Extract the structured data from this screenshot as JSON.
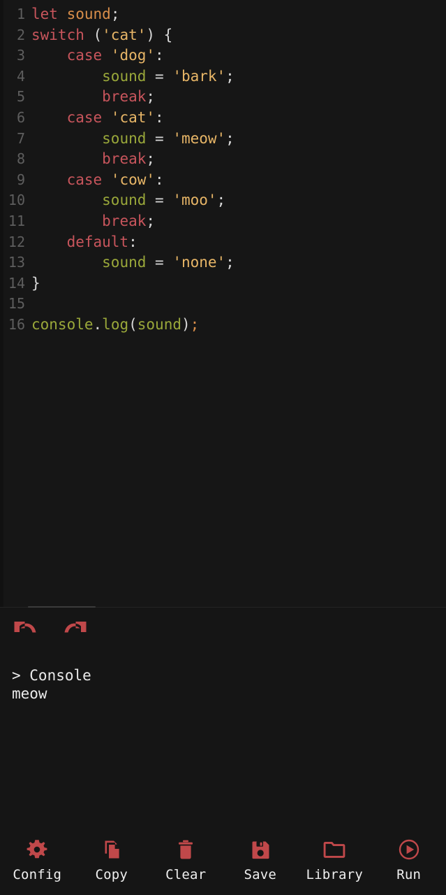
{
  "theme": {
    "background": "#151515",
    "editor_background": "#161616",
    "accent_red": "#c0484a",
    "keyword_color": "#c8555c",
    "string_color": "#e8b667",
    "variable_color": "#9aa83a",
    "declaration_color": "#d98e4a",
    "punctuation_color": "#d8d8d8",
    "line_number_color": "#5e5e5e",
    "console_text_color": "#eaeaea"
  },
  "editor": {
    "language": "javascript",
    "line_count": 16,
    "lines": [
      {
        "number": "1",
        "tokens": [
          {
            "t": "let",
            "c": "t-kw"
          },
          {
            "t": " ",
            "c": "t-plain"
          },
          {
            "t": "sound",
            "c": "t-decl"
          },
          {
            "t": ";",
            "c": "t-punc"
          }
        ]
      },
      {
        "number": "2",
        "tokens": [
          {
            "t": "switch",
            "c": "t-kw"
          },
          {
            "t": " (",
            "c": "t-punc"
          },
          {
            "t": "'cat'",
            "c": "t-str"
          },
          {
            "t": ") {",
            "c": "t-punc"
          }
        ]
      },
      {
        "number": "3",
        "tokens": [
          {
            "t": "    ",
            "c": "t-plain"
          },
          {
            "t": "case",
            "c": "t-kw"
          },
          {
            "t": " ",
            "c": "t-plain"
          },
          {
            "t": "'dog'",
            "c": "t-str"
          },
          {
            "t": ":",
            "c": "t-punc"
          }
        ]
      },
      {
        "number": "4",
        "tokens": [
          {
            "t": "        ",
            "c": "t-plain"
          },
          {
            "t": "sound",
            "c": "t-var"
          },
          {
            "t": " = ",
            "c": "t-punc"
          },
          {
            "t": "'bark'",
            "c": "t-str"
          },
          {
            "t": ";",
            "c": "t-punc"
          }
        ]
      },
      {
        "number": "5",
        "tokens": [
          {
            "t": "        ",
            "c": "t-plain"
          },
          {
            "t": "break",
            "c": "t-kw"
          },
          {
            "t": ";",
            "c": "t-punc"
          }
        ]
      },
      {
        "number": "6",
        "tokens": [
          {
            "t": "    ",
            "c": "t-plain"
          },
          {
            "t": "case",
            "c": "t-kw"
          },
          {
            "t": " ",
            "c": "t-plain"
          },
          {
            "t": "'cat'",
            "c": "t-str"
          },
          {
            "t": ":",
            "c": "t-punc"
          }
        ]
      },
      {
        "number": "7",
        "tokens": [
          {
            "t": "        ",
            "c": "t-plain"
          },
          {
            "t": "sound",
            "c": "t-var"
          },
          {
            "t": " = ",
            "c": "t-punc"
          },
          {
            "t": "'meow'",
            "c": "t-str"
          },
          {
            "t": ";",
            "c": "t-punc"
          }
        ]
      },
      {
        "number": "8",
        "tokens": [
          {
            "t": "        ",
            "c": "t-plain"
          },
          {
            "t": "break",
            "c": "t-kw"
          },
          {
            "t": ";",
            "c": "t-punc"
          }
        ]
      },
      {
        "number": "9",
        "tokens": [
          {
            "t": "    ",
            "c": "t-plain"
          },
          {
            "t": "case",
            "c": "t-kw"
          },
          {
            "t": " ",
            "c": "t-plain"
          },
          {
            "t": "'cow'",
            "c": "t-str"
          },
          {
            "t": ":",
            "c": "t-punc"
          }
        ]
      },
      {
        "number": "10",
        "tokens": [
          {
            "t": "        ",
            "c": "t-plain"
          },
          {
            "t": "sound",
            "c": "t-var"
          },
          {
            "t": " = ",
            "c": "t-punc"
          },
          {
            "t": "'moo'",
            "c": "t-str"
          },
          {
            "t": ";",
            "c": "t-punc"
          }
        ]
      },
      {
        "number": "11",
        "tokens": [
          {
            "t": "        ",
            "c": "t-plain"
          },
          {
            "t": "break",
            "c": "t-kw"
          },
          {
            "t": ";",
            "c": "t-punc"
          }
        ]
      },
      {
        "number": "12",
        "tokens": [
          {
            "t": "    ",
            "c": "t-plain"
          },
          {
            "t": "default",
            "c": "t-kw"
          },
          {
            "t": ":",
            "c": "t-punc"
          }
        ]
      },
      {
        "number": "13",
        "tokens": [
          {
            "t": "        ",
            "c": "t-plain"
          },
          {
            "t": "sound",
            "c": "t-var"
          },
          {
            "t": " = ",
            "c": "t-punc"
          },
          {
            "t": "'none'",
            "c": "t-str"
          },
          {
            "t": ";",
            "c": "t-punc"
          }
        ]
      },
      {
        "number": "14",
        "tokens": [
          {
            "t": "}",
            "c": "t-punc"
          }
        ]
      },
      {
        "number": "15",
        "tokens": [
          {
            "t": "",
            "c": "t-plain"
          }
        ]
      },
      {
        "number": "16",
        "tokens": [
          {
            "t": "console",
            "c": "t-var"
          },
          {
            "t": ".",
            "c": "t-punc"
          },
          {
            "t": "log",
            "c": "t-var"
          },
          {
            "t": "(",
            "c": "t-punc"
          },
          {
            "t": "sound",
            "c": "t-var"
          },
          {
            "t": ")",
            "c": "t-punc"
          },
          {
            "t": ";",
            "c": "t-semi"
          }
        ]
      }
    ],
    "plain_text": "let sound;\nswitch ('cat') {\n    case 'dog':\n        sound = 'bark';\n        break;\n    case 'cat':\n        sound = 'meow';\n        break;\n    case 'cow':\n        sound = 'moo';\n        break;\n    default:\n        sound = 'none';\n}\n\nconsole.log(sound);"
  },
  "history": {
    "undo": {
      "label": "Undo",
      "icon": "undo-arrow-icon"
    },
    "redo": {
      "label": "Redo",
      "icon": "redo-arrow-icon"
    }
  },
  "console": {
    "header": "> Console",
    "lines": [
      "meow"
    ]
  },
  "toolbar": {
    "buttons": [
      {
        "label": "Config",
        "icon": "gear-icon"
      },
      {
        "label": "Copy",
        "icon": "copy-icon"
      },
      {
        "label": "Clear",
        "icon": "trash-icon"
      },
      {
        "label": "Save",
        "icon": "floppy-disk-icon"
      },
      {
        "label": "Library",
        "icon": "folder-icon"
      },
      {
        "label": "Run",
        "icon": "play-circle-icon"
      }
    ]
  }
}
